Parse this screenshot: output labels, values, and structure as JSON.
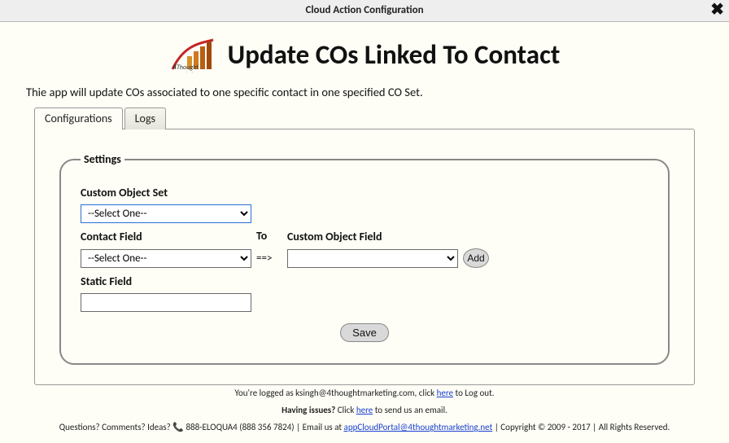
{
  "window": {
    "title": "Cloud Action Configuration"
  },
  "hero": {
    "title": "Update COs Linked To Contact"
  },
  "intro": "Thie app will update COs associated to one specific contact in one specified CO Set.",
  "tabs": {
    "items": [
      "Configurations",
      "Logs"
    ],
    "active": 0
  },
  "settings": {
    "legend": "Settings",
    "labels": {
      "co_set": "Custom Object Set",
      "contact_field": "Contact Field",
      "to": "To",
      "co_field": "Custom Object Field",
      "static_field": "Static Field",
      "arrow": "==>"
    },
    "values": {
      "co_set": "--Select One--",
      "contact_field": "--Select One--",
      "co_field": "",
      "static_field": ""
    },
    "buttons": {
      "add": "Add",
      "save": "Save"
    }
  },
  "footer": {
    "line1_a": "You're logged as ksingh@4thoughtmarketing.com, click ",
    "line1_link": "here",
    "line1_b": " to Log out.",
    "line2_a": "Having issues? ",
    "line2_b": "Click ",
    "line2_link": "here",
    "line2_c": " to send us an email.",
    "line3_a": "Questions? Comments? Ideas? ",
    "line3_phone": " 888-ELOQUA4 (888 356 7824) ",
    "line3_b": "| Email us at ",
    "line3_email": "appCloudPortal@4thoughtmarketing.net",
    "line3_c": " | Copyright ",
    "line3_years": " 2009 - 2017 | All Rights Reserved."
  }
}
